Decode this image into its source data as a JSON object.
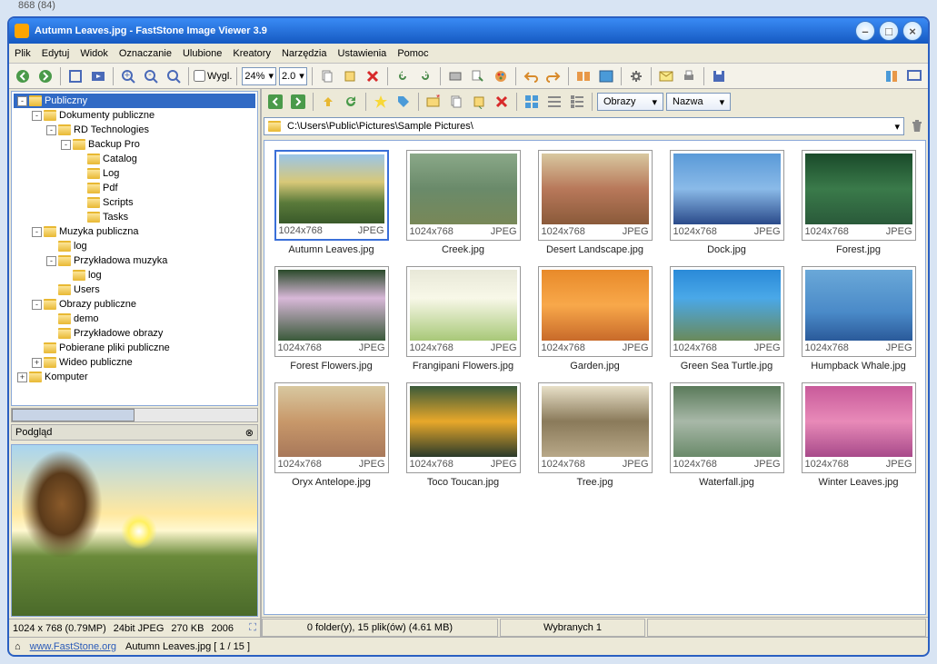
{
  "top_hint": "868 (84)",
  "title": "Autumn Leaves.jpg  -  FastStone Image Viewer 3.9",
  "menu": [
    "Plik",
    "Edytuj",
    "Widok",
    "Oznaczanie",
    "Ulubione",
    "Kreatory",
    "Narzędzia",
    "Ustawienia",
    "Pomoc"
  ],
  "toolbar": {
    "wygl_label": "Wygl.",
    "zoom_a": "24%",
    "zoom_b": "2.0"
  },
  "tree": [
    {
      "depth": 0,
      "toggle": "-",
      "label": "Publiczny",
      "sel": true
    },
    {
      "depth": 1,
      "toggle": "-",
      "label": "Dokumenty publiczne"
    },
    {
      "depth": 2,
      "toggle": "-",
      "label": "RD Technologies"
    },
    {
      "depth": 3,
      "toggle": "-",
      "label": "Backup Pro"
    },
    {
      "depth": 4,
      "toggle": "",
      "label": "Catalog"
    },
    {
      "depth": 4,
      "toggle": "",
      "label": "Log"
    },
    {
      "depth": 4,
      "toggle": "",
      "label": "Pdf"
    },
    {
      "depth": 4,
      "toggle": "",
      "label": "Scripts"
    },
    {
      "depth": 4,
      "toggle": "",
      "label": "Tasks"
    },
    {
      "depth": 1,
      "toggle": "-",
      "label": "Muzyka publiczna"
    },
    {
      "depth": 2,
      "toggle": "",
      "label": "log"
    },
    {
      "depth": 2,
      "toggle": "-",
      "label": "Przykładowa muzyka"
    },
    {
      "depth": 3,
      "toggle": "",
      "label": "log"
    },
    {
      "depth": 2,
      "toggle": "",
      "label": "Users"
    },
    {
      "depth": 1,
      "toggle": "-",
      "label": "Obrazy publiczne"
    },
    {
      "depth": 2,
      "toggle": "",
      "label": "demo"
    },
    {
      "depth": 2,
      "toggle": "",
      "label": "Przykładowe obrazy"
    },
    {
      "depth": 1,
      "toggle": "",
      "label": "Pobierane pliki publiczne"
    },
    {
      "depth": 1,
      "toggle": "+",
      "label": "Wideo publiczne"
    },
    {
      "depth": 0,
      "toggle": "+",
      "label": "Komputer"
    }
  ],
  "preview_label": "Podgląd",
  "left_status": {
    "dims": "1024 x 768 (0.79MP)",
    "depth": "24bit JPEG",
    "size": "270 KB",
    "year": "2006"
  },
  "nav": {
    "select1": "Obrazy",
    "select2": "Nazwa"
  },
  "path": "C:\\Users\\Public\\Pictures\\Sample Pictures\\",
  "thumbs": [
    {
      "name": "Autumn Leaves.jpg",
      "dims": "1024x768",
      "fmt": "JPEG",
      "bg": "linear-gradient(to bottom,#9ac5e8 0%,#d8c878 40%,#5a7a3a 70%,#3a5a2a 100%)",
      "sel": true
    },
    {
      "name": "Creek.jpg",
      "dims": "1024x768",
      "fmt": "JPEG",
      "bg": "linear-gradient(to bottom,#8aa888 0%,#6a8a6a 50%,#788858 100%)"
    },
    {
      "name": "Desert Landscape.jpg",
      "dims": "1024x768",
      "fmt": "JPEG",
      "bg": "linear-gradient(to bottom,#d8c8a0 0%,#b8785a 50%,#8a5a3a 100%)"
    },
    {
      "name": "Dock.jpg",
      "dims": "1024x768",
      "fmt": "JPEG",
      "bg": "linear-gradient(to bottom,#5a9ad8 0%,#8abae8 50%,#2a4a8a 100%)"
    },
    {
      "name": "Forest.jpg",
      "dims": "1024x768",
      "fmt": "JPEG",
      "bg": "linear-gradient(to bottom,#1a4a2a 0%,#3a7a4a 50%,#2a5a3a 100%)"
    },
    {
      "name": "Forest Flowers.jpg",
      "dims": "1024x768",
      "fmt": "JPEG",
      "bg": "linear-gradient(to bottom,#2a4a2a 0%,#d8b8d8 40%,#3a5a3a 100%)"
    },
    {
      "name": "Frangipani Flowers.jpg",
      "dims": "1024x768",
      "fmt": "JPEG",
      "bg": "linear-gradient(to bottom,#e8e8d8 0%,#f8f8e8 40%,#a8c878 100%)"
    },
    {
      "name": "Garden.jpg",
      "dims": "1024x768",
      "fmt": "JPEG",
      "bg": "linear-gradient(to bottom,#e88a2a 0%,#f8a84a 50%,#c86a2a 100%)"
    },
    {
      "name": "Green Sea Turtle.jpg",
      "dims": "1024x768",
      "fmt": "JPEG",
      "bg": "linear-gradient(to bottom,#2a8ad8 0%,#4aa8e8 40%,#6a8a5a 100%)"
    },
    {
      "name": "Humpback Whale.jpg",
      "dims": "1024x768",
      "fmt": "JPEG",
      "bg": "linear-gradient(to bottom,#6aa8d8 0%,#4a8ac8 60%,#2a5a9a 100%)"
    },
    {
      "name": "Oryx Antelope.jpg",
      "dims": "1024x768",
      "fmt": "JPEG",
      "bg": "linear-gradient(to bottom,#d8c8a0 0%,#c8986a 50%,#a8785a 100%)"
    },
    {
      "name": "Toco Toucan.jpg",
      "dims": "1024x768",
      "fmt": "JPEG",
      "bg": "linear-gradient(to bottom,#3a5a3a 0%,#e8a82a 50%,#2a3a2a 100%)"
    },
    {
      "name": "Tree.jpg",
      "dims": "1024x768",
      "fmt": "JPEG",
      "bg": "linear-gradient(to bottom,#e8e0c8 0%,#8a7a5a 50%,#b8a888 100%)"
    },
    {
      "name": "Waterfall.jpg",
      "dims": "1024x768",
      "fmt": "JPEG",
      "bg": "linear-gradient(to bottom,#5a7a5a 0%,#a8b8a8 50%,#6a8a6a 100%)"
    },
    {
      "name": "Winter Leaves.jpg",
      "dims": "1024x768",
      "fmt": "JPEG",
      "bg": "linear-gradient(to bottom,#c85a9a 0%,#e88ab8 50%,#a84a8a 100%)"
    }
  ],
  "status": {
    "folders": "0 folder(y), 15 plik(ów) (4.61 MB)",
    "selected": "Wybranych 1"
  },
  "bottom": {
    "site": "www.FastStone.org",
    "file": "Autumn Leaves.jpg [ 1 / 15 ]"
  }
}
